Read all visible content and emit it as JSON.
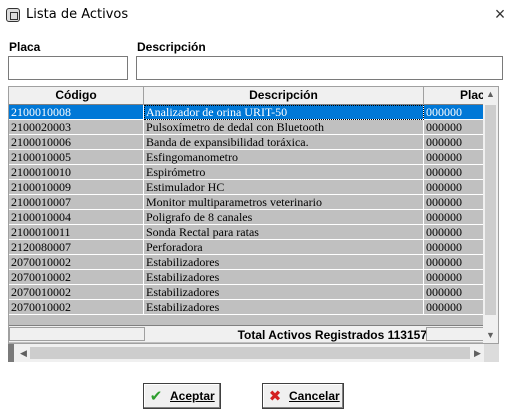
{
  "window": {
    "title": "Lista de Activos",
    "close_icon": "×"
  },
  "filters": {
    "placa_label": "Placa",
    "placa_value": "",
    "descripcion_label": "Descripción",
    "descripcion_value": ""
  },
  "grid": {
    "columns": [
      "Código",
      "Descripción",
      "Plac"
    ],
    "rows": [
      {
        "codigo": "2100010008",
        "descripcion": "Analizador de orina URIT-50",
        "placa": "000000",
        "selected": true
      },
      {
        "codigo": "2100020003",
        "descripcion": "Pulsoxímetro de dedal con Bluetooth",
        "placa": "000000"
      },
      {
        "codigo": "2100010006",
        "descripcion": "Banda de expansibilidad toráxica.",
        "placa": "000000"
      },
      {
        "codigo": "2100010005",
        "descripcion": "Esfingomanometro",
        "placa": "000000"
      },
      {
        "codigo": "2100010010",
        "descripcion": "Espirómetro",
        "placa": "000000"
      },
      {
        "codigo": "2100010009",
        "descripcion": "Estimulador HC",
        "placa": "000000"
      },
      {
        "codigo": "2100010007",
        "descripcion": "Monitor multiparametros veterinario",
        "placa": "000000"
      },
      {
        "codigo": "2100010004",
        "descripcion": "Poligrafo de 8 canales",
        "placa": "000000"
      },
      {
        "codigo": "2100010011",
        "descripcion": "Sonda Rectal para ratas",
        "placa": "000000"
      },
      {
        "codigo": "2120080007",
        "descripcion": "Perforadora",
        "placa": "000000"
      },
      {
        "codigo": "2070010002",
        "descripcion": "Estabilizadores",
        "placa": "000000"
      },
      {
        "codigo": "2070010002",
        "descripcion": "Estabilizadores",
        "placa": "000000"
      },
      {
        "codigo": "2070010002",
        "descripcion": "Estabilizadores",
        "placa": "000000"
      },
      {
        "codigo": "2070010002",
        "descripcion": "Estabilizadores",
        "placa": "000000"
      }
    ],
    "footer_total": "Total Activos Registrados 113157"
  },
  "buttons": {
    "aceptar_label": "Aceptar",
    "aceptar_icon": "check-icon",
    "cancelar_label": "Cancelar",
    "cancelar_icon": "cancel-icon"
  },
  "colors": {
    "selection": "#0078d7",
    "grid_bg": "#c0c0c0",
    "check_green": "#2e9e2e",
    "cancel_red": "#d42020"
  }
}
